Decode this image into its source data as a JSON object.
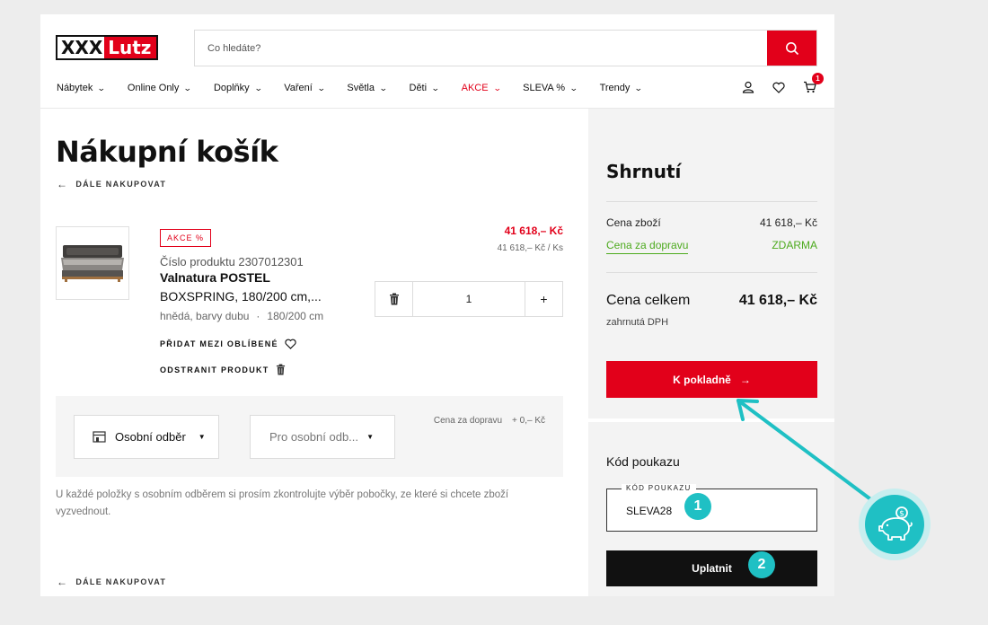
{
  "header": {
    "logo_left": "XXX",
    "logo_right": "Lutz",
    "search_placeholder": "Co hledáte?",
    "nav": [
      {
        "label": "Nábytek",
        "red": false
      },
      {
        "label": "Online Only",
        "red": false
      },
      {
        "label": "Doplňky",
        "red": false
      },
      {
        "label": "Vaření",
        "red": false
      },
      {
        "label": "Světla",
        "red": false
      },
      {
        "label": "Děti",
        "red": false
      },
      {
        "label": "AKCE",
        "red": true
      },
      {
        "label": "SLEVA %",
        "red": false
      },
      {
        "label": "Trendy",
        "red": false
      }
    ],
    "cart_count": "1",
    "icons": [
      "user-icon",
      "heart-icon",
      "cart-icon",
      "search-icon"
    ]
  },
  "cart": {
    "title": "Nákupní košík",
    "back_label": "DÁLE NAKUPOVAT",
    "item": {
      "tag": "AKCE %",
      "product_number": "Číslo produktu 2307012301",
      "name_line1": "Valnatura POSTEL",
      "name_line2": "BOXSPRING, 180/200 cm,...",
      "color": "hnědá, barvy dubu",
      "separator": "·",
      "size": "180/200 cm",
      "price": "41 618,– Kč",
      "unit_price": "41 618,– Kč / Ks",
      "quantity": "1",
      "minus_label": "+",
      "favorite_label": "PŘIDAT MEZI OBLÍBENÉ",
      "remove_label": "ODSTRANIT PRODUKT"
    },
    "shipping": {
      "option_selected": "Osobní odběr",
      "store_placeholder": "Pro osobní odb...",
      "cost_label": "Cena za dopravu",
      "cost_value": "+ 0,– Kč"
    },
    "note": "U každé položky s osobním odběrem si prosím zkontrolujte výběr pobočky, ze které si chcete zboží vyzvednout."
  },
  "summary": {
    "title": "Shrnutí",
    "goods_label": "Cena zboží",
    "goods_value": "41 618,– Kč",
    "shipping_label": "Cena za dopravu",
    "shipping_value": "ZDARMA",
    "total_label": "Cena celkem",
    "total_value": "41 618,– Kč",
    "vat_note": "zahrnutá DPH",
    "checkout_label": "K pokladně",
    "voucher_title": "Kód poukazu",
    "voucher_field_label": "KÓD POUKAZU",
    "voucher_value": "SLEVA28",
    "apply_label": "Uplatnit"
  },
  "overlay": {
    "step1": "1",
    "step2": "2",
    "accent": "#1fc0c4"
  },
  "colors": {
    "brand": "#e2001a",
    "green": "#4caa1d"
  }
}
